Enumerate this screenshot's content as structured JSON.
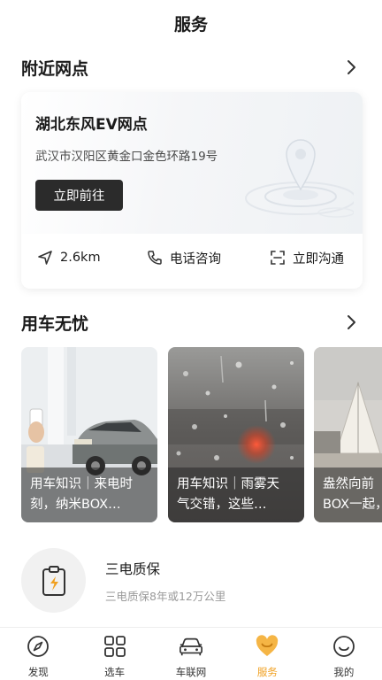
{
  "header": {
    "title": "服务"
  },
  "nearby": {
    "title": "附近网点",
    "dealer_name": "湖北东风EV网点",
    "address": "武汉市汉阳区黄金口金色环路19号",
    "go_label": "立即前往",
    "distance": "2.6km",
    "phone_label": "电话咨询",
    "chat_label": "立即沟通"
  },
  "worry_free": {
    "title": "用车无忧",
    "articles": [
      {
        "line1": "用车知识｜来电时",
        "line2": "刻，纳米BOX…"
      },
      {
        "line1": "用车知识｜雨雾天",
        "line2": "气交错，这些…"
      },
      {
        "line1": "盎然向前",
        "line2": "BOX一起，"
      }
    ]
  },
  "warranty": {
    "title": "三电质保",
    "subtitle": "三电质保8年或12万公里",
    "icon": "battery-clipboard-icon"
  },
  "tabs": [
    {
      "label": "发现",
      "icon": "compass-icon",
      "active": false
    },
    {
      "label": "选车",
      "icon": "grid-icon",
      "active": false
    },
    {
      "label": "车联网",
      "icon": "car-icon",
      "active": false
    },
    {
      "label": "服务",
      "icon": "heart-service-icon",
      "active": true
    },
    {
      "label": "我的",
      "icon": "smiley-icon",
      "active": false
    }
  ],
  "colors": {
    "accent": "#f0a020",
    "button_dark": "#2b2b2b",
    "text": "#1a1a1a"
  }
}
